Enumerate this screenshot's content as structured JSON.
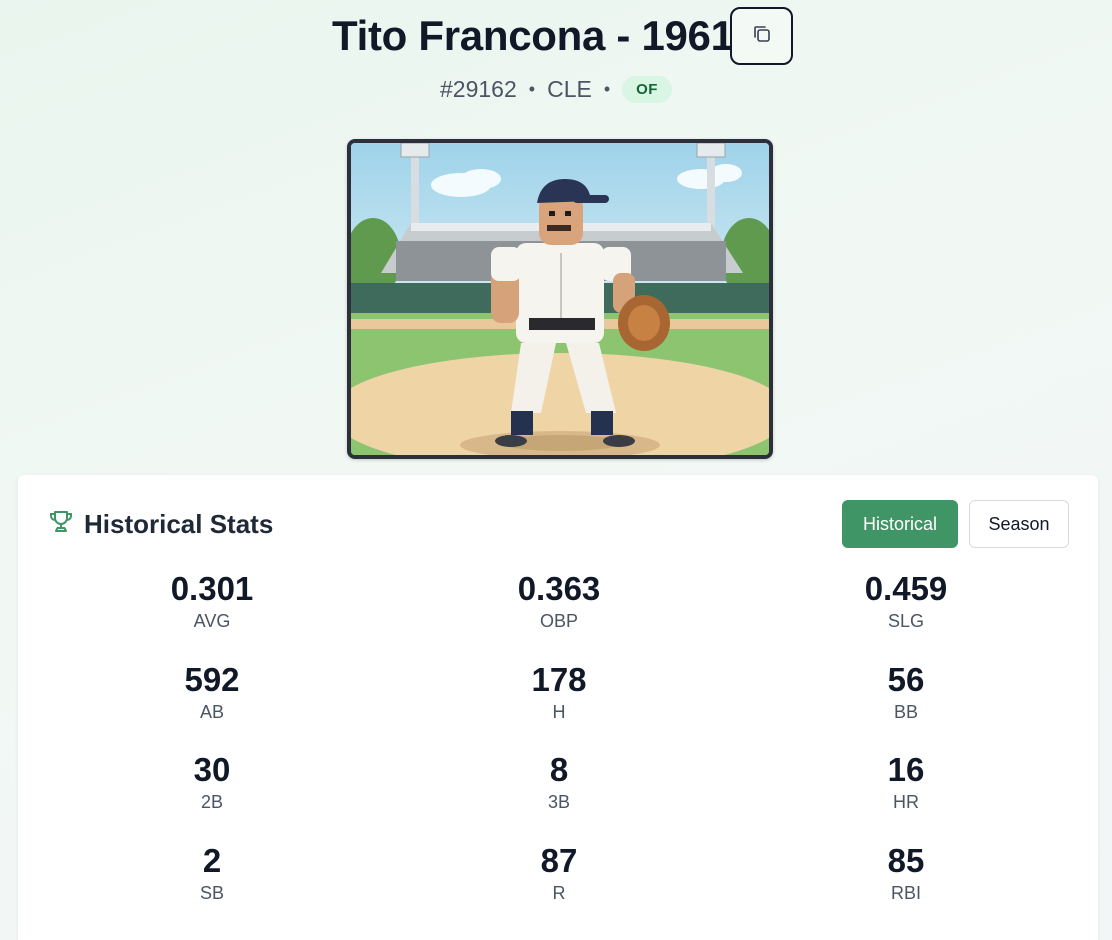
{
  "player": {
    "title": "Tito Francona - 1961",
    "id": "#29162",
    "team": "CLE",
    "position": "OF",
    "separator": "•"
  },
  "icons": {
    "copy": "copy-icon",
    "trophy": "trophy-icon"
  },
  "colors": {
    "accent": "#3f9566",
    "badge_bg": "#d9f5e4",
    "badge_text": "#166534"
  },
  "stats_panel": {
    "title": "Historical Stats",
    "tabs": [
      {
        "label": "Historical",
        "active": true
      },
      {
        "label": "Season",
        "active": false
      }
    ],
    "stats": [
      {
        "value": "0.301",
        "label": "AVG"
      },
      {
        "value": "0.363",
        "label": "OBP"
      },
      {
        "value": "0.459",
        "label": "SLG"
      },
      {
        "value": "592",
        "label": "AB"
      },
      {
        "value": "178",
        "label": "H"
      },
      {
        "value": "56",
        "label": "BB"
      },
      {
        "value": "30",
        "label": "2B"
      },
      {
        "value": "8",
        "label": "3B"
      },
      {
        "value": "16",
        "label": "HR"
      },
      {
        "value": "2",
        "label": "SB"
      },
      {
        "value": "87",
        "label": "R"
      },
      {
        "value": "85",
        "label": "RBI"
      }
    ]
  }
}
